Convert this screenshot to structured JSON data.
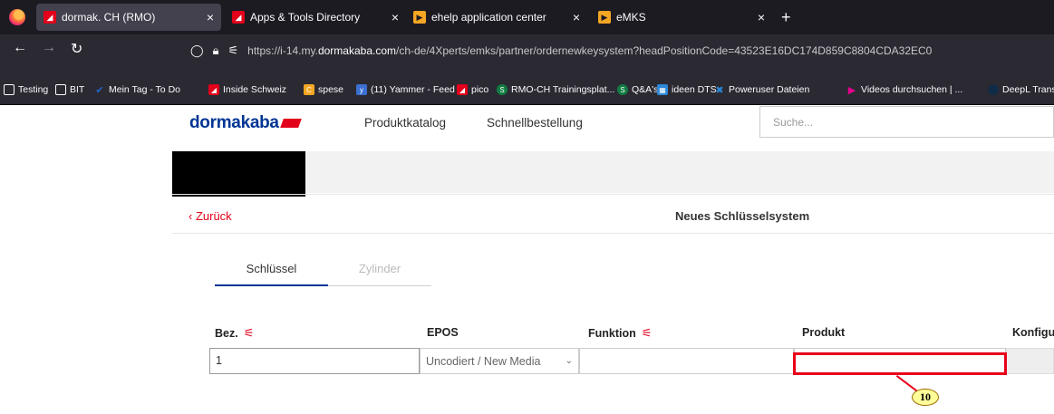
{
  "browser": {
    "tabs": [
      {
        "title": "dormak. CH (RMO)",
        "icon": "dormakaba-favicon",
        "active": true
      },
      {
        "title": "Apps & Tools Directory",
        "icon": "dormakaba-favicon",
        "active": false
      },
      {
        "title": "ehelp application center",
        "icon": "ehelp-favicon",
        "active": false
      },
      {
        "title": "eMKS",
        "icon": "ehelp-favicon",
        "active": false
      }
    ],
    "new_tab": "+",
    "close_glyph": "×",
    "url_prefix": "https://i-14.my.",
    "url_host": "dormakaba.com",
    "url_path": "/ch-de/4Xperts/emks/partner/ordernewkeysystem?headPositionCode=43523E16DC174D859C8804CDA32EC0",
    "bookmarks": [
      "Testing",
      "BIT",
      "Mein Tag - To Do",
      "Inside Schweiz",
      "spese",
      "(11) Yammer - Feed",
      "pico",
      "RMO-CH Trainingsplat...",
      "Q&A's",
      "ideen DTS",
      "Poweruser Dateien",
      "Videos durchsuchen | ...",
      "DeepL Transl"
    ]
  },
  "site": {
    "logo": "dormakaba",
    "nav": [
      "Produktkatalog",
      "Schnellbestellung"
    ],
    "search_placeholder": "Suche..."
  },
  "page": {
    "back_label": "‹ Zurück",
    "title": "Neues Schlüsselsystem",
    "tabs": [
      {
        "label": "Schlüssel",
        "selected": true
      },
      {
        "label": "Zylinder",
        "selected": false
      }
    ],
    "columns": [
      "Bez.",
      "EPOS",
      "Funktion",
      "Produkt",
      "Konfigu"
    ],
    "row": {
      "bez": "1",
      "epos": "Uncodiert / New Media",
      "funktion": "",
      "produkt": "",
      "konfig": ""
    }
  },
  "annotation": {
    "callout_number": "10",
    "color": "#e8001a"
  },
  "colors": {
    "brand_blue": "#003594",
    "brand_red": "#e2001a"
  }
}
